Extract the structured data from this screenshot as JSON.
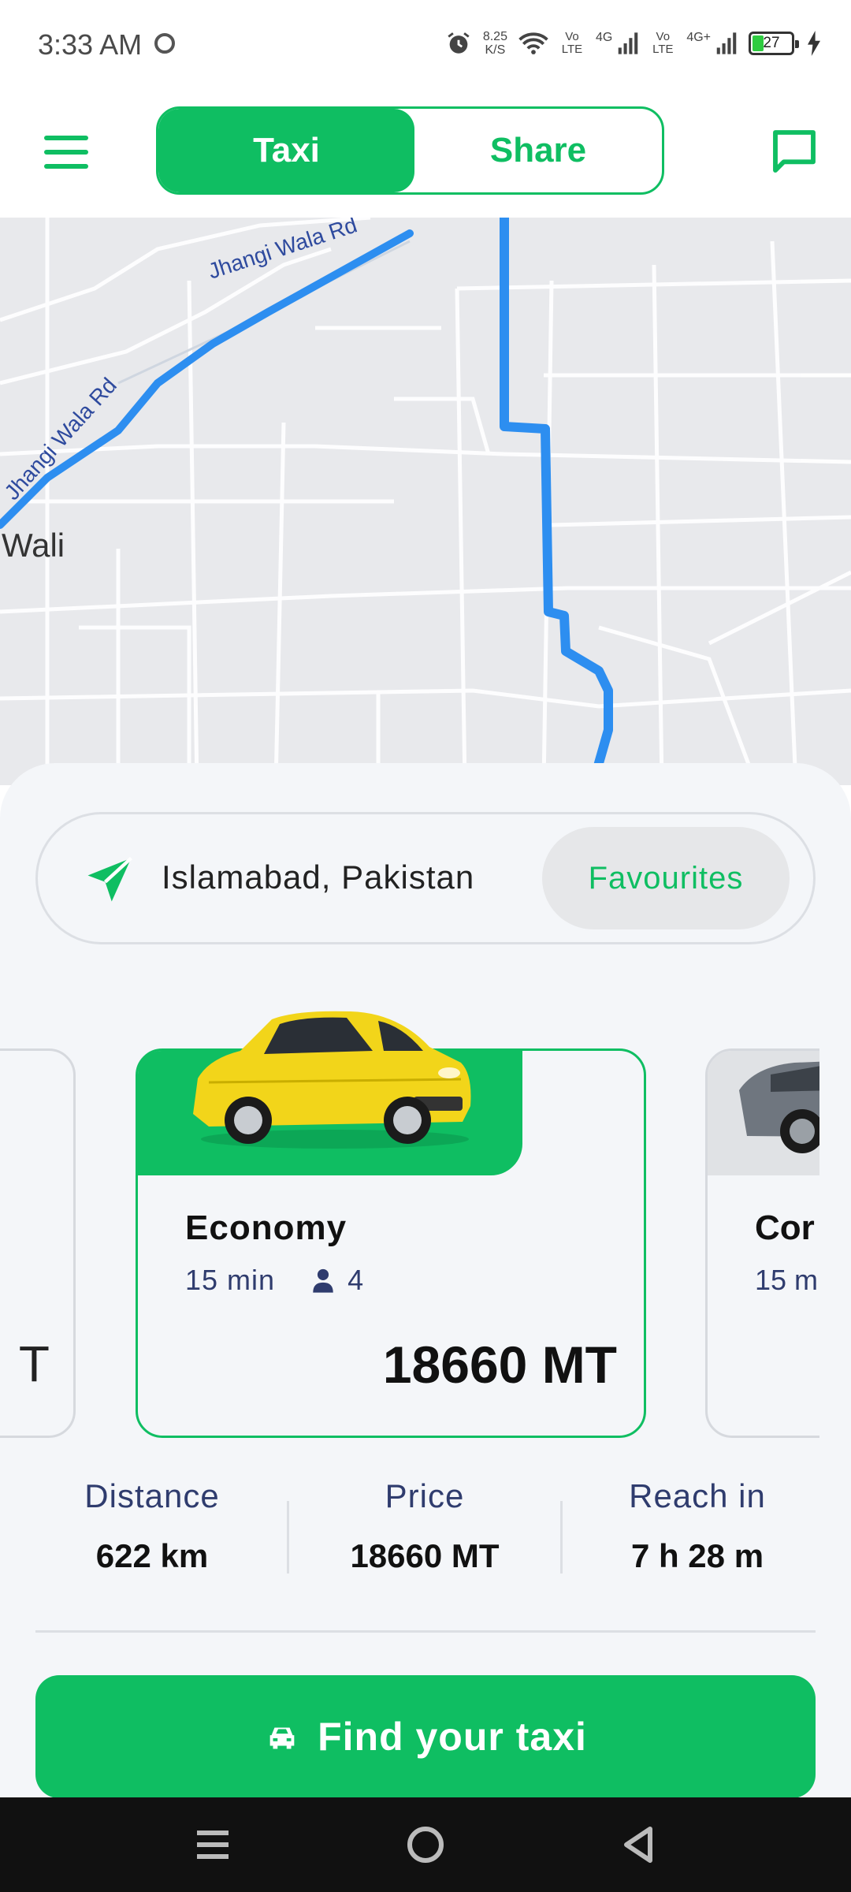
{
  "status_bar": {
    "time": "3:33 AM",
    "net_speed_value": "8.25",
    "net_speed_unit": "K/S",
    "volte_1": "Vo LTE",
    "signal_1_tag": "4G",
    "volte_2": "Vo LTE",
    "signal_2_tag": "4G+",
    "battery_level": "27",
    "icons": [
      "alarm-icon",
      "wifi-icon",
      "signal-icon",
      "battery-icon",
      "charging-icon"
    ]
  },
  "header": {
    "menu_icon": "hamburger-icon",
    "tabs": [
      {
        "label": "Taxi",
        "selected": true
      },
      {
        "label": "Share",
        "selected": false
      }
    ],
    "chat_icon": "chat-icon"
  },
  "map": {
    "road_labels": [
      "Jhangi Wala Rd",
      "Jhangi Wala Rd"
    ],
    "place_label": "Wali",
    "route_color": "#2d8ef0"
  },
  "location": {
    "value": "Islamabad, Pakistan",
    "favourites_label": "Favourites"
  },
  "vehicles": [
    {
      "title": "",
      "price_fragment": "T"
    },
    {
      "title": "Economy",
      "eta": "15 min",
      "seats": "4",
      "price": "18660 MT",
      "selected": true
    },
    {
      "title": "Cor",
      "eta": "15 m"
    }
  ],
  "stats": [
    {
      "label": "Distance",
      "value": "622 km"
    },
    {
      "label": "Price",
      "value": "18660 MT"
    },
    {
      "label": "Reach in",
      "value": "7 h 28 m"
    }
  ],
  "cta": {
    "label": "Find your taxi",
    "icon": "taxi-icon"
  },
  "theme": {
    "accent": "#0fbe62",
    "secondary_text": "#2f3c6e"
  }
}
